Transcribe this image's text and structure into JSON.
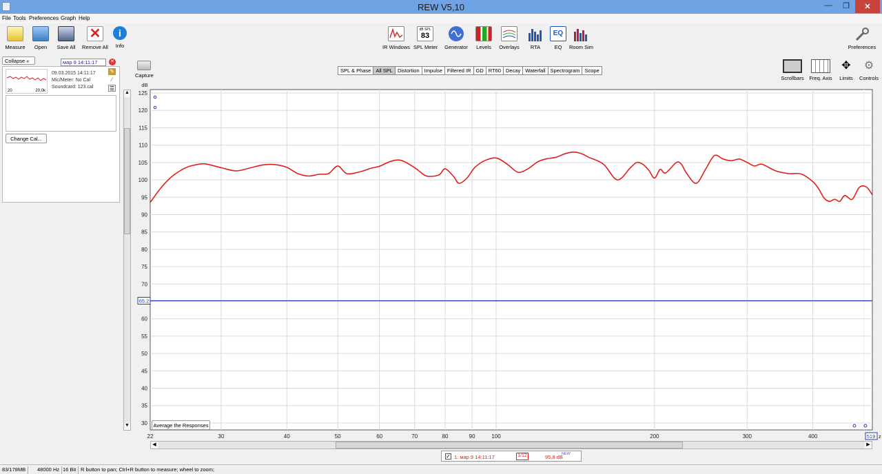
{
  "window": {
    "title": "REW V5,10"
  },
  "menu": [
    "File",
    "Tools",
    "Preferences",
    "Graph",
    "Help"
  ],
  "toolbar": {
    "left": [
      "Measure",
      "Open",
      "Save All",
      "Remove All",
      "Info"
    ],
    "center": [
      "IR Windows",
      "SPL Meter",
      "Generator",
      "Levels",
      "Overlays",
      "RTA",
      "EQ",
      "Room Sim"
    ],
    "spl_meter_unit": "dB SPL",
    "spl_meter_value": "83",
    "eq_icon_text": "EQ",
    "right": "Preferences"
  },
  "left_panel": {
    "collapse_label": "Collapse",
    "measurement_name": "мар 9 14:11:17",
    "thumb_min": "20",
    "thumb_max": "20,0k",
    "date": "09.03.2015 14:11:17",
    "mic": "Mic/Meter: No Cal",
    "soundcard": "Soundcard: 123.cal",
    "change_cal": "Change Cal..."
  },
  "capture": {
    "label": "Capture"
  },
  "tabs": [
    {
      "label": "SPL & Phase",
      "selected": false
    },
    {
      "label": "All SPL",
      "selected": true
    },
    {
      "label": "Distortion",
      "selected": false
    },
    {
      "label": "Impulse",
      "selected": false
    },
    {
      "label": "Filtered IR",
      "selected": false
    },
    {
      "label": "GD",
      "selected": false
    },
    {
      "label": "RT60",
      "selected": false
    },
    {
      "label": "Decay",
      "selected": false
    },
    {
      "label": "Waterfall",
      "selected": false
    },
    {
      "label": "Spectrogram",
      "selected": false
    },
    {
      "label": "Scope",
      "selected": false
    }
  ],
  "graph_controls": [
    "Scrollbars",
    "Freq. Axis",
    "Limits",
    "Controls"
  ],
  "average_button": "Average the Responses",
  "legend": {
    "name": "1: мар 9 14:11:17",
    "smoothing": "1/12",
    "value": "95,8 dB",
    "badge": "NEW"
  },
  "status": {
    "memory": "83/178MB",
    "rate": "48000 Hz",
    "bits": "16 Bit",
    "hint": "R button to pan; Ctrl+R button to measure; wheel to zoom;"
  },
  "chart_data": {
    "type": "line",
    "ylabel": "dB",
    "ylim": [
      28,
      126
    ],
    "yticks": [
      125,
      120,
      115,
      110,
      105,
      100,
      95,
      90,
      85,
      80,
      75,
      70,
      65,
      60,
      55,
      50,
      45,
      40,
      35,
      30
    ],
    "x_scale": "log",
    "xlim": [
      22,
      519
    ],
    "xticks": [
      22,
      30,
      40,
      50,
      60,
      70,
      80,
      90,
      100,
      200,
      300,
      400
    ],
    "x_cursor_label": "519",
    "x_unit_fragment": "z",
    "grid": true,
    "cursor_line": {
      "value": 65.2,
      "label": "65,2",
      "color": "#2b3fa6"
    },
    "series": [
      {
        "color": "#e01e1e",
        "x": [
          22,
          23,
          24,
          25,
          26,
          27,
          28,
          30,
          32,
          34,
          36,
          38,
          40,
          42,
          44,
          46,
          48,
          50,
          52,
          55,
          58,
          60,
          63,
          66,
          70,
          73,
          75,
          78,
          80,
          83,
          85,
          88,
          91,
          95,
          100,
          105,
          110,
          115,
          120,
          125,
          130,
          135,
          140,
          145,
          150,
          160,
          170,
          180,
          185,
          190,
          195,
          200,
          205,
          210,
          220,
          225,
          230,
          240,
          250,
          260,
          270,
          280,
          290,
          300,
          310,
          320,
          340,
          360,
          380,
          400,
          410,
          420,
          430,
          440,
          450,
          460,
          475,
          490,
          505,
          519
        ],
        "y": [
          93.5,
          97.5,
          100.5,
          102.5,
          103.8,
          104.4,
          104.6,
          103.5,
          102.6,
          103.4,
          104.3,
          104.4,
          103.6,
          101.8,
          101.1,
          101.6,
          101.8,
          104.0,
          101.8,
          102.3,
          103.4,
          103.9,
          105.3,
          105.6,
          103.5,
          101.4,
          101.0,
          101.5,
          103.2,
          101.0,
          99.0,
          100.5,
          103.5,
          105.5,
          106.3,
          104.5,
          102.2,
          103.2,
          105.2,
          106.1,
          106.5,
          107.5,
          108.0,
          107.6,
          106.5,
          104.5,
          100.0,
          103.5,
          105.0,
          104.5,
          102.8,
          100.5,
          103.0,
          102.0,
          105.0,
          104.5,
          102.0,
          99.0,
          103.0,
          107.0,
          106.0,
          105.5,
          106.0,
          105.0,
          104.0,
          104.5,
          102.6,
          101.8,
          101.7,
          99.5,
          97.5,
          94.8,
          93.8,
          94.4,
          93.8,
          95.5,
          94.4,
          97.8,
          98.0,
          95.7
        ]
      }
    ]
  }
}
